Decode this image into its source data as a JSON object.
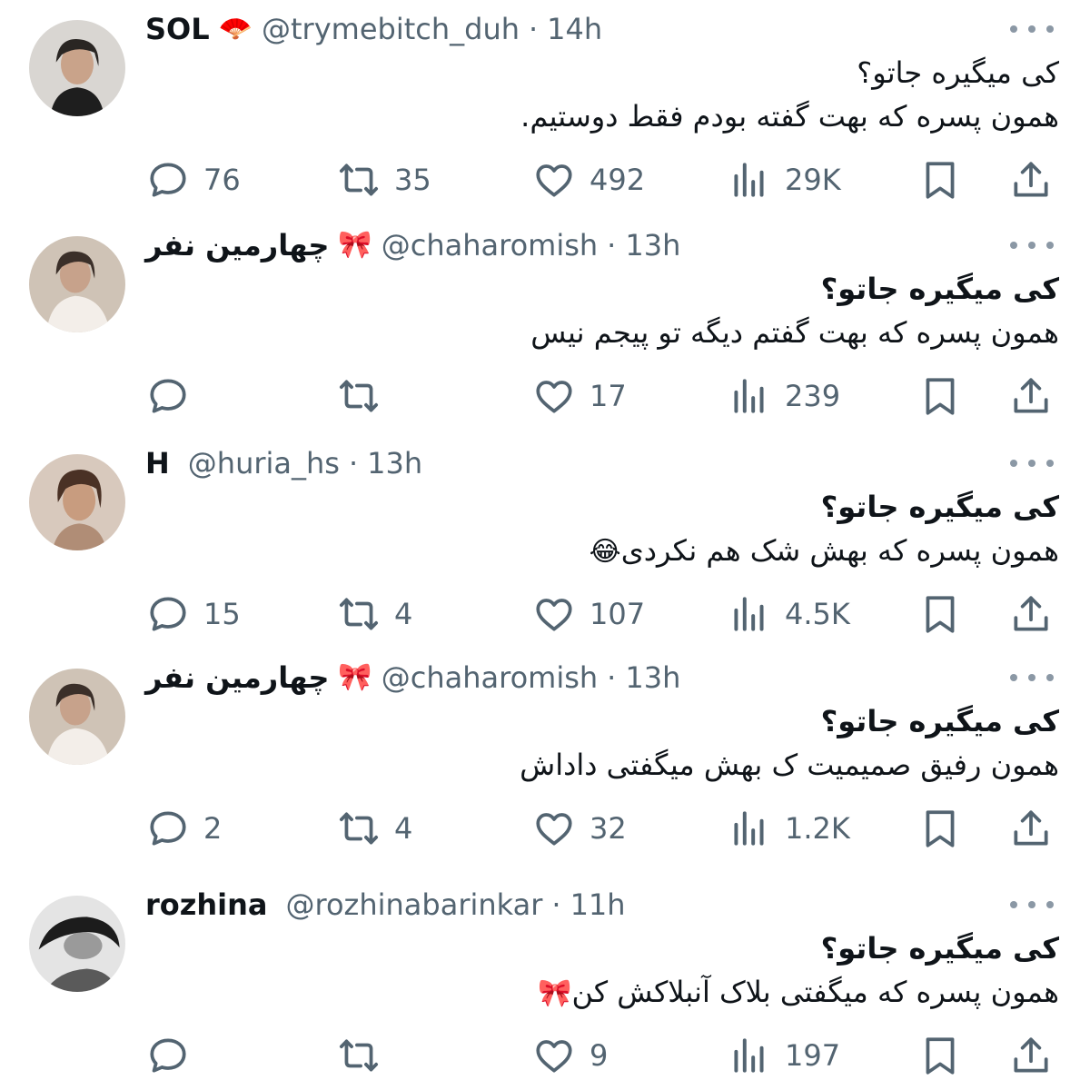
{
  "tweets": [
    {
      "name": "SOL",
      "name_emoji": "🪭",
      "handle": "@trymebitch_duh",
      "time": "14h",
      "line1": "کی میگیره جاتو؟",
      "line2": "همون پسره که بهت گفته بودم فقط دوستیم.",
      "line2_emoji": "",
      "first_line_bold": false,
      "replies": "76",
      "retweets": "35",
      "likes": "492",
      "views": "29K"
    },
    {
      "name": "چهارمین نفر",
      "name_emoji": "🎀",
      "handle": "@chaharomish",
      "time": "13h",
      "line1": "کی میگیره جاتو؟",
      "line2": "همون پسره که بهت گفتم دیگه تو پیجم نیس",
      "line2_emoji": "",
      "first_line_bold": true,
      "replies": "",
      "retweets": "",
      "likes": "17",
      "views": "239"
    },
    {
      "name": "H",
      "name_emoji": "",
      "handle": "@huria_hs",
      "time": "13h",
      "line1": "کی میگیره جاتو؟",
      "line2": "همون پسره که بهش شک هم نکردی",
      "line2_emoji": "😂",
      "first_line_bold": true,
      "replies": "15",
      "retweets": "4",
      "likes": "107",
      "views": "4.5K"
    },
    {
      "name": "چهارمین نفر",
      "name_emoji": "🎀",
      "handle": "@chaharomish",
      "time": "13h",
      "line1": "کی میگیره جاتو؟",
      "line2": "همون رفیق صمیمیت ک بهش میگفتی داداش",
      "line2_emoji": "",
      "first_line_bold": true,
      "replies": "2",
      "retweets": "4",
      "likes": "32",
      "views": "1.2K"
    },
    {
      "name": "rozhina",
      "name_emoji": "",
      "handle": "@rozhinabarinkar",
      "time": "11h",
      "line1": "کی میگیره جاتو؟",
      "line2": "همون پسره که میگفتی بلاک آنبلاکش کن",
      "line2_emoji": "🎀",
      "first_line_bold": true,
      "replies": "",
      "retweets": "",
      "likes": "9",
      "views": "197"
    }
  ],
  "separator": "·",
  "colors": {
    "text": "#0f1419",
    "secondary": "#536471",
    "background": "#ffffff"
  },
  "icons": [
    "reply-icon",
    "retweet-icon",
    "like-icon",
    "views-icon",
    "bookmark-icon",
    "share-icon",
    "more-icon"
  ]
}
